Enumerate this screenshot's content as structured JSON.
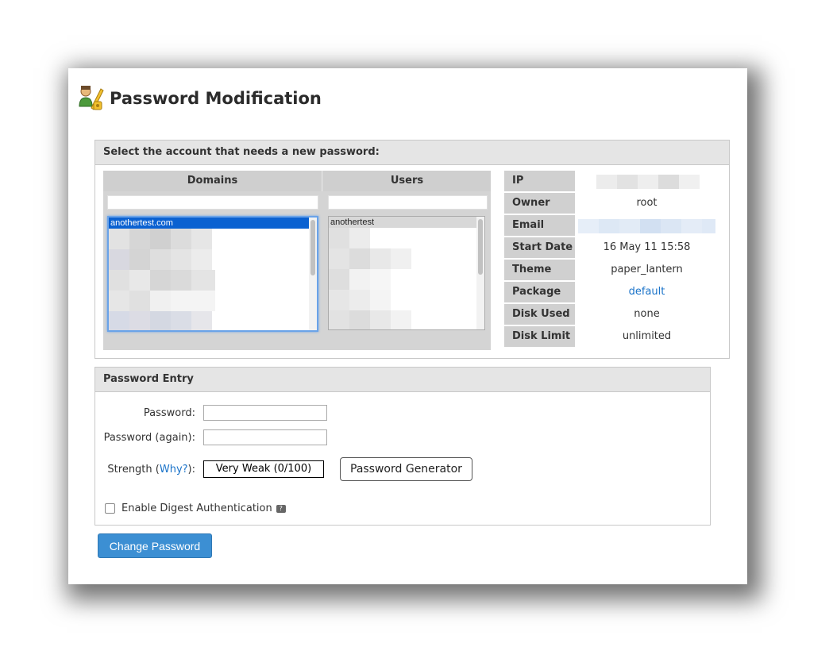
{
  "page": {
    "title": "Password Modification",
    "icon": "user-key-icon"
  },
  "account_panel": {
    "heading": "Select the account that needs a new password:",
    "domains": {
      "header": "Domains",
      "filter_value": "",
      "items": [
        "anothertest.com"
      ],
      "selected": "anothertest.com"
    },
    "users": {
      "header": "Users",
      "filter_value": "",
      "items": [
        "anothertest"
      ],
      "selected": "anothertest"
    }
  },
  "account_info": {
    "rows": [
      {
        "label": "IP",
        "value": ""
      },
      {
        "label": "Owner",
        "value": "root"
      },
      {
        "label": "Email",
        "value": ""
      },
      {
        "label": "Start Date",
        "value": "16 May 11 15:58"
      },
      {
        "label": "Theme",
        "value": "paper_lantern"
      },
      {
        "label": "Package",
        "value": "default"
      },
      {
        "label": "Disk Used",
        "value": "none"
      },
      {
        "label": "Disk Limit",
        "value": "unlimited"
      }
    ]
  },
  "password_entry": {
    "heading": "Password Entry",
    "password_label": "Password:",
    "password_value": "",
    "password_again_label": "Password (again):",
    "password_again_value": "",
    "strength_label_prefix": "Strength (",
    "strength_why": "Why?",
    "strength_label_suffix": "):",
    "strength_value": "Very Weak (0/100)",
    "generator_label": "Password Generator",
    "digest_label": "Enable Digest Authentication",
    "digest_checked": false
  },
  "submit": {
    "label": "Change Password"
  },
  "colors": {
    "primary": "#3c8fd3",
    "link": "#1a73c9",
    "selected": "#0a61d1"
  }
}
